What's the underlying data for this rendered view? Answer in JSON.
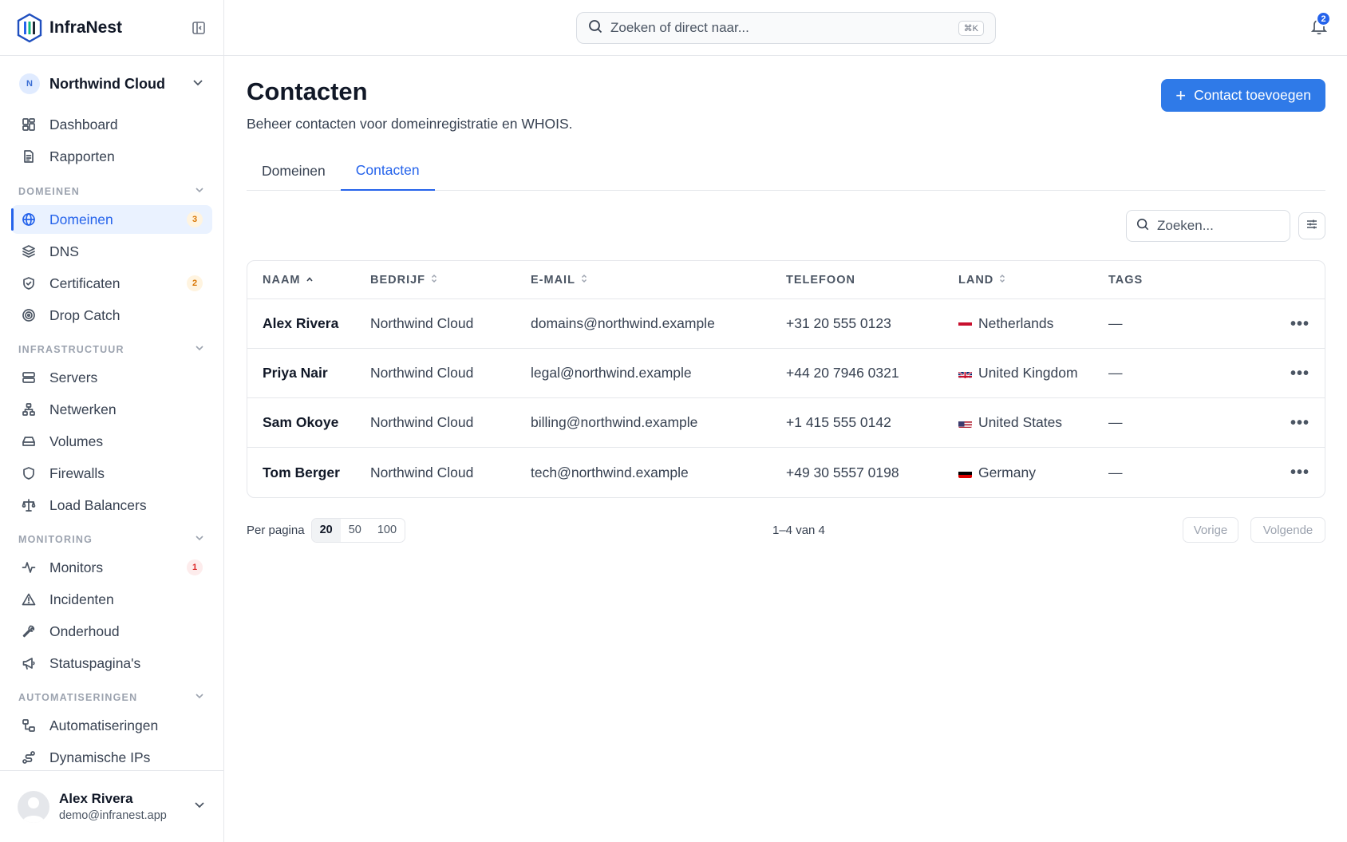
{
  "brand": {
    "name": "InfraNest"
  },
  "org": {
    "initial": "N",
    "name": "Northwind Cloud"
  },
  "nav": {
    "top": [
      {
        "label": "Dashboard",
        "icon": "dashboard-icon"
      },
      {
        "label": "Rapporten",
        "icon": "report-icon"
      }
    ],
    "sections": [
      {
        "title": "DOMEINEN",
        "items": [
          {
            "label": "Domeinen",
            "icon": "globe-icon",
            "badge": "3",
            "active": true
          },
          {
            "label": "DNS",
            "icon": "layers-icon"
          },
          {
            "label": "Certificaten",
            "icon": "shield-check-icon",
            "badge": "2"
          },
          {
            "label": "Drop Catch",
            "icon": "target-icon"
          }
        ]
      },
      {
        "title": "INFRASTRUCTUUR",
        "items": [
          {
            "label": "Servers",
            "icon": "server-icon"
          },
          {
            "label": "Netwerken",
            "icon": "network-icon"
          },
          {
            "label": "Volumes",
            "icon": "drive-icon"
          },
          {
            "label": "Firewalls",
            "icon": "shield-icon"
          },
          {
            "label": "Load Balancers",
            "icon": "scale-icon"
          }
        ]
      },
      {
        "title": "MONITORING",
        "items": [
          {
            "label": "Monitors",
            "icon": "activity-icon",
            "badge": "1"
          },
          {
            "label": "Incidenten",
            "icon": "alert-triangle-icon"
          },
          {
            "label": "Onderhoud",
            "icon": "wrench-icon"
          },
          {
            "label": "Statuspagina's",
            "icon": "megaphone-icon"
          }
        ]
      },
      {
        "title": "AUTOMATISERINGEN",
        "items": [
          {
            "label": "Automatiseringen",
            "icon": "workflow-icon"
          },
          {
            "label": "Dynamische IPs",
            "icon": "route-icon"
          }
        ]
      }
    ]
  },
  "user": {
    "name": "Alex Rivera",
    "email": "demo@infranest.app"
  },
  "topbar": {
    "search_placeholder": "Zoeken of direct naar...",
    "shortcut": "⌘K",
    "notifications": "2"
  },
  "page": {
    "title": "Contacten",
    "subtitle": "Beheer contacten voor domeinregistratie en WHOIS.",
    "add_button": "Contact toevoegen",
    "tabs": [
      "Domeinen",
      "Contacten"
    ],
    "active_tab": 1,
    "search_placeholder": "Zoeken..."
  },
  "table": {
    "columns": [
      "NAAM",
      "BEDRIJF",
      "E-MAIL",
      "TELEFOON",
      "LAND",
      "TAGS"
    ],
    "rows": [
      {
        "name": "Alex Rivera",
        "company": "Northwind Cloud",
        "email": "domains@northwind.example",
        "phone": "+31 20 555 0123",
        "country": "Netherlands",
        "flag": "nl",
        "tags": "—"
      },
      {
        "name": "Priya Nair",
        "company": "Northwind Cloud",
        "email": "legal@northwind.example",
        "phone": "+44 20 7946 0321",
        "country": "United Kingdom",
        "flag": "gb",
        "tags": "—"
      },
      {
        "name": "Sam Okoye",
        "company": "Northwind Cloud",
        "email": "billing@northwind.example",
        "phone": "+1 415 555 0142",
        "country": "United States",
        "flag": "us",
        "tags": "—"
      },
      {
        "name": "Tom Berger",
        "company": "Northwind Cloud",
        "email": "tech@northwind.example",
        "phone": "+49 30 5557 0198",
        "country": "Germany",
        "flag": "de",
        "tags": "—"
      }
    ]
  },
  "pagination": {
    "per_page_label": "Per pagina",
    "options": [
      "20",
      "50",
      "100"
    ],
    "selected": "20",
    "range": "1–4 van 4",
    "prev": "Vorige",
    "next": "Volgende"
  },
  "colors": {
    "accent": "#2f7ae8",
    "active_bg": "#eaf2ff"
  }
}
